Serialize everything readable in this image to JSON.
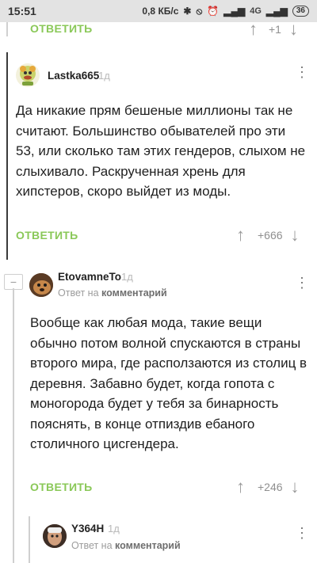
{
  "status": {
    "time": "15:51",
    "speed": "0,8 КБ/с",
    "signal": "4G",
    "battery": "36"
  },
  "top": {
    "reply_label": "ОТВЕТИТЬ",
    "vote": "+1"
  },
  "comments": [
    {
      "username": "Lastka665",
      "ago": "1д",
      "text": "Да никакие прям бешеные миллионы так не считают. Большинство обывателей про эти 53, или сколько там этих гендеров, слыхом не слыхивало. Раскрученная хрень для хипстеров, скоро выйдет из моды.",
      "reply_label": "ОТВЕТИТЬ",
      "vote": "+666"
    },
    {
      "username": "EtovamneTo",
      "ago": "1д",
      "reply_prefix": "Ответ на",
      "reply_target": "комментарий",
      "text": "Вообще как любая мода, такие вещи обычно потом волной спускаются в страны второго мира, где расползаются из столиц в деревня. Забавно будет, когда гопота с моногорода будет у тебя за бинарность пояснять, в конце отпиздив ебаного столичного цисгендера.",
      "reply_label": "ОТВЕТИТЬ",
      "vote": "+246"
    },
    {
      "username": "Y364H",
      "ago": "1д",
      "reply_prefix": "Ответ на",
      "reply_target": "комментарий"
    }
  ],
  "colors": {
    "accent": "#8ac858"
  }
}
